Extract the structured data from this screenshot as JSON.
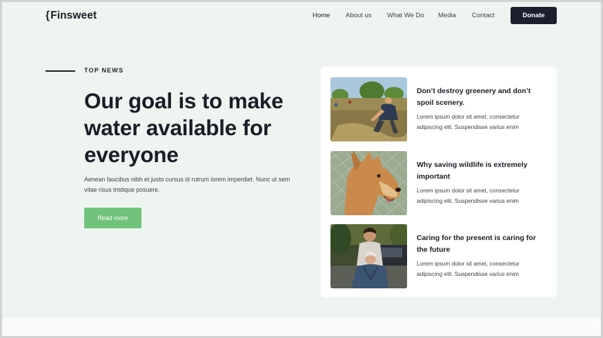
{
  "brand": {
    "brace": "{",
    "name": "Finsweet"
  },
  "nav": {
    "items": [
      {
        "label": "Home",
        "active": true
      },
      {
        "label": "About us",
        "active": false
      },
      {
        "label": "What We Do",
        "active": false
      },
      {
        "label": "Media",
        "active": false
      },
      {
        "label": "Contact",
        "active": false
      }
    ],
    "cta_label": "Donate"
  },
  "hero": {
    "eyebrow": "TOP NEWS",
    "title": "Our goal is to make water available for everyone",
    "text": "Aenean faucibus nibh et justo cursus id rutrum lorem imperdiet. Nunc ut sem vitae risus tristique posuere.",
    "button_label": "Read more"
  },
  "news": [
    {
      "title": "Don’t destroy greenery and don’t spoil scenery.",
      "body": "Lorem ipsum dolor sit amet, consectetur adipiscing elit. Suspendisse varius enim"
    },
    {
      "title": "Why saving wildlife is extremely important",
      "body": "Lorem ipsum dolor sit amet, consectetur adipiscing elit. Suspendisse varius enim"
    },
    {
      "title": "Caring for the present is caring for the future",
      "body": "Lorem ipsum dolor sit amet, consectetur adipiscing elit. Suspendisse varius enim"
    }
  ],
  "colors": {
    "background": "#eef5f0",
    "dark": "#1b1d26",
    "accent_green": "#71c27b",
    "donate_bg": "#1d1f2e"
  }
}
